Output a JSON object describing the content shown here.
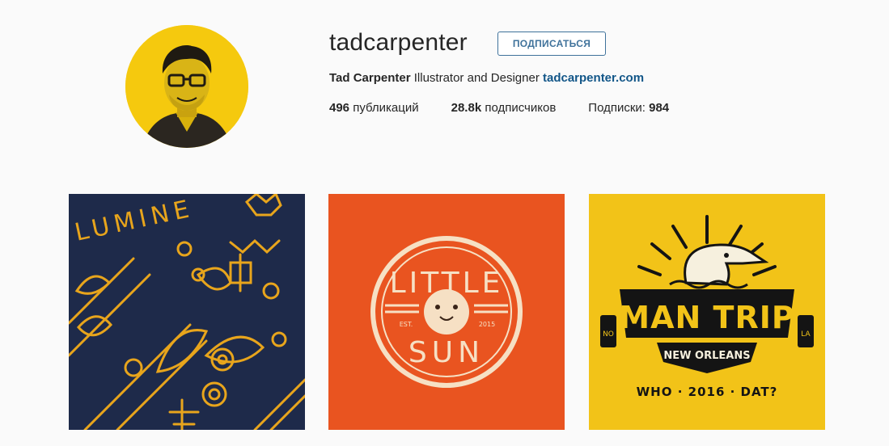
{
  "profile": {
    "username": "tadcarpenter",
    "follow_label": "ПОДПИСАТЬСЯ",
    "full_name": "Tad Carpenter",
    "bio_text": " Illustrator and Designer ",
    "website": "tadcarpenter.com"
  },
  "stats": {
    "posts_count": "496",
    "posts_label": " публикаций",
    "followers_count": "28.8k",
    "followers_label": " подписчиков",
    "following_label": "Подписки: ",
    "following_count": "984"
  },
  "posts": [
    {
      "text": "LUMINE"
    },
    {
      "top_text": "LITTLE",
      "bottom_text": "SUN",
      "est": "EST.",
      "year": "2015"
    },
    {
      "line1": "MAN TRIP",
      "line2": "NEW ORLEANS",
      "line3": "WHO · 2016 · DAT?",
      "left_badge": "NO",
      "right_badge": "LA"
    }
  ],
  "colors": {
    "accent": "#3f729b",
    "link": "#125688",
    "tile1_bg": "#1e2a4a",
    "tile2_bg": "#e95420",
    "tile3_bg": "#f2c318"
  }
}
